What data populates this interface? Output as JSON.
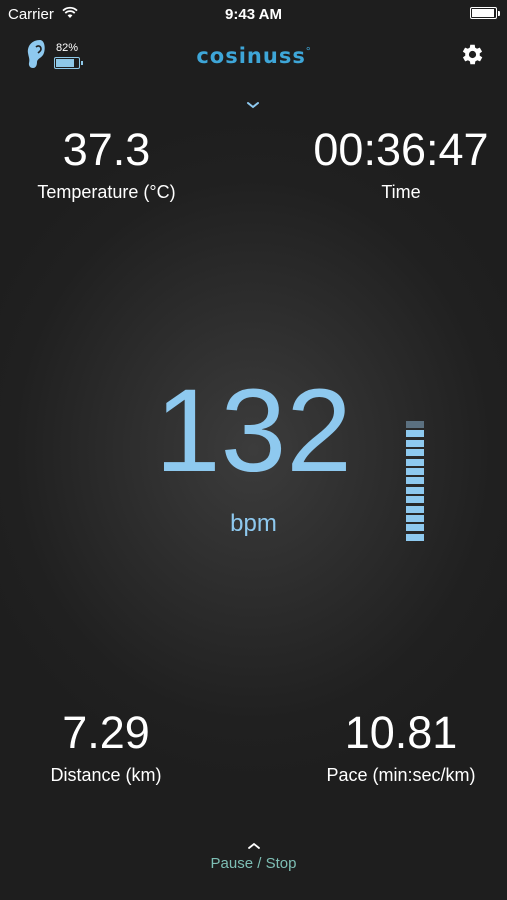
{
  "status_bar": {
    "carrier": "Carrier",
    "time": "9:43 AM"
  },
  "header": {
    "device_battery_percent": "82%",
    "device_battery_level": 0.82,
    "logo_text": "cosinuss",
    "logo_mark": "°"
  },
  "metrics": {
    "temperature": {
      "value": "37.3",
      "label": "Temperature (°C)"
    },
    "time": {
      "value": "00:36:47",
      "label": "Time"
    },
    "distance": {
      "value": "7.29",
      "label": "Distance (km)"
    },
    "pace": {
      "value": "10.81",
      "label": "Pace (min:sec/km)"
    }
  },
  "heart_rate": {
    "value": "132",
    "unit": "bpm",
    "zone_segments_total": 13,
    "zone_segments_active": 12
  },
  "footer": {
    "pause_stop_label": "Pause / Stop"
  },
  "colors": {
    "accent": "#8ec9ef",
    "logo": "#3ea6d8",
    "footer_text": "#7ebfb5",
    "background": "#1f1f1f"
  },
  "icons": {
    "ear": "ear-sensor-icon",
    "settings": "gear-icon",
    "expand": "chevron-down-icon",
    "collapse": "chevron-up-icon",
    "wifi": "wifi-icon",
    "battery": "battery-icon"
  }
}
